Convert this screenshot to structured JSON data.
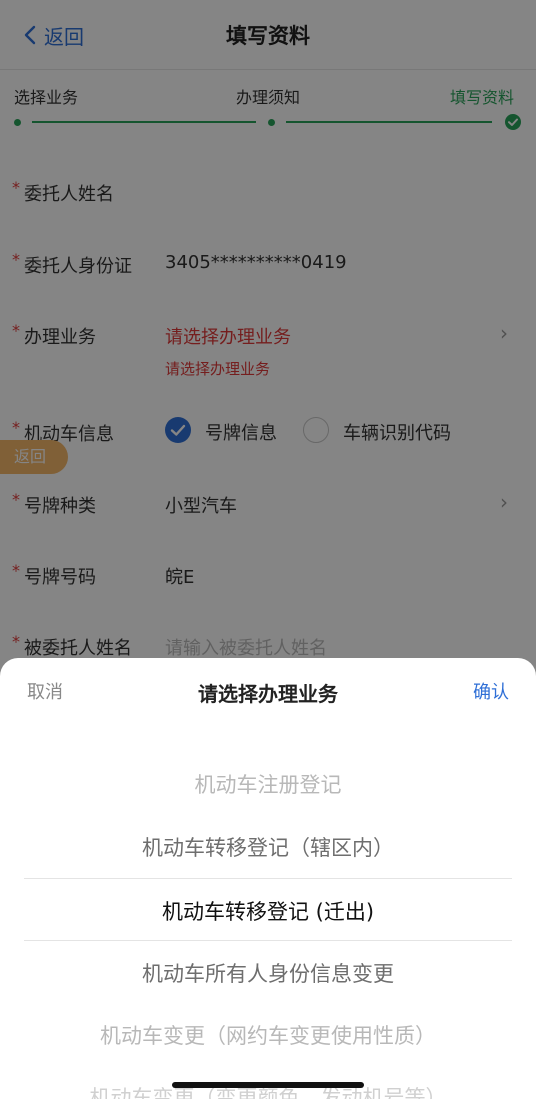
{
  "navbar": {
    "back_label": "返回",
    "title": "填写资料"
  },
  "steps": [
    {
      "label": "选择业务",
      "status": "done"
    },
    {
      "label": "办理须知",
      "status": "done"
    },
    {
      "label": "填写资料",
      "status": "current"
    }
  ],
  "form": {
    "fields": [
      {
        "label": "委托人姓名",
        "value": ""
      },
      {
        "label": "委托人身份证",
        "value": "3405**********0419"
      },
      {
        "label": "办理业务",
        "value": "请选择办理业务",
        "hint": "请选择办理业务"
      },
      {
        "label": "机动车信息",
        "options": [
          "号牌信息",
          "车辆识别代码"
        ],
        "selected": "号牌信息"
      },
      {
        "label": "号牌种类",
        "value": "小型汽车"
      },
      {
        "label": "号牌号码",
        "value": "皖E"
      },
      {
        "label": "被委托人姓名",
        "placeholder": "请输入被委托人姓名"
      }
    ]
  },
  "float_back_label": "返回",
  "sheet": {
    "cancel_label": "取消",
    "title": "请选择办理业务",
    "confirm_label": "确认",
    "options": [
      "机动车注册登记",
      "机动车转移登记（辖区内）",
      "机动车转移登记 (迁出)",
      "机动车所有人身份信息变更",
      "机动车变更（网约车变更使用性质）",
      "机动车变更（变更颜色、发动机号等）"
    ],
    "selected_index": 2
  },
  "colors": {
    "accent_blue": "#2f6fd6",
    "success_green": "#2aa35a",
    "required_red": "#e03b3b",
    "float_orange": "#f5b86a"
  }
}
